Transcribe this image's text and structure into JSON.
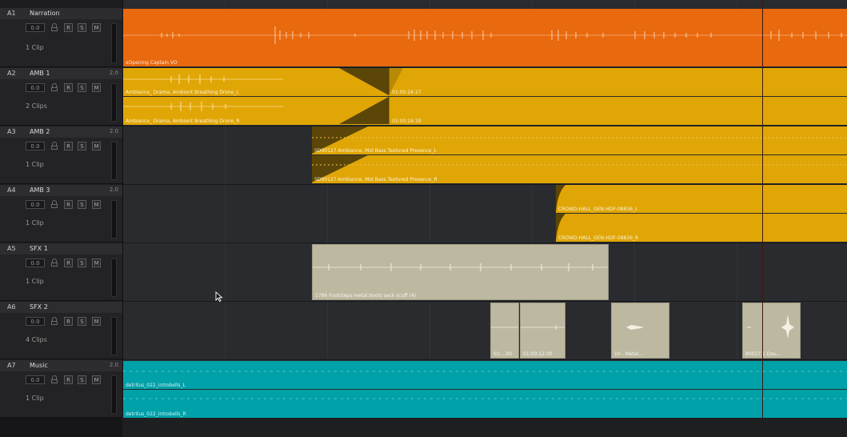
{
  "tracks": [
    {
      "id": "A1",
      "name": "Narration",
      "channels": "",
      "volume": "0.0",
      "clips": "1 Clip"
    },
    {
      "id": "A2",
      "name": "AMB 1",
      "channels": "2.0",
      "volume": "0.0",
      "clips": "2 Clips"
    },
    {
      "id": "A3",
      "name": "AMB 2",
      "channels": "2.0",
      "volume": "0.0",
      "clips": "1 Clip"
    },
    {
      "id": "A4",
      "name": "AMB 3",
      "channels": "2.0",
      "volume": "0.0",
      "clips": "1 Clip"
    },
    {
      "id": "A5",
      "name": "SFX 1",
      "channels": "",
      "volume": "0.0",
      "clips": "1 Clip"
    },
    {
      "id": "A6",
      "name": "SFX 2",
      "channels": "",
      "volume": "0.0",
      "clips": "4 Clips"
    },
    {
      "id": "A7",
      "name": "Music",
      "channels": "2.0",
      "volume": "0.0",
      "clips": "1 Clip"
    }
  ],
  "buttons": {
    "record": "R",
    "solo": "S",
    "mute": "M"
  },
  "clip_labels": {
    "narration": "xOpening Captain VO",
    "amb1_l": "Ambiance_ Drama, Ambient Breathing Drone_L",
    "amb1_l_tc": "01:00:24:17",
    "amb1_r": "Ambiance_ Drama, Ambient Breathing Drone_R",
    "amb1_r_tc": "01:00:24:19",
    "amb2_l": "SD90127 Ambiance, Mid Bass Textured Presence_L",
    "amb2_r": "SD90127 Ambiance, Mid Bass Textured Presence_R",
    "amb3_l": "CROWD-HALL_GEN-HDF-08836_L",
    "amb3_r": "CROWD-HALL_GEN-HDF-08836_R",
    "sfx1": "1786 Footsteps metal boots sack scuff (4)",
    "sfx2_a": "01:...00",
    "sfx2_b": "01:00:12:00",
    "sfx2_c": "10 - Metal...",
    "sfx2_d": "80027 1 Dou...",
    "music_l": "detritus_022_introbells_L",
    "music_r": "detritus_022_introbells_R"
  },
  "colors": {
    "narration": "#e9690e",
    "amb": "#e0a606",
    "sfx": "#bdb8a0",
    "music": "#00a1a9",
    "playhead": "#3a1810"
  },
  "icons": {
    "lock": "lock-icon",
    "cursor": "mouse-pointer-icon"
  }
}
